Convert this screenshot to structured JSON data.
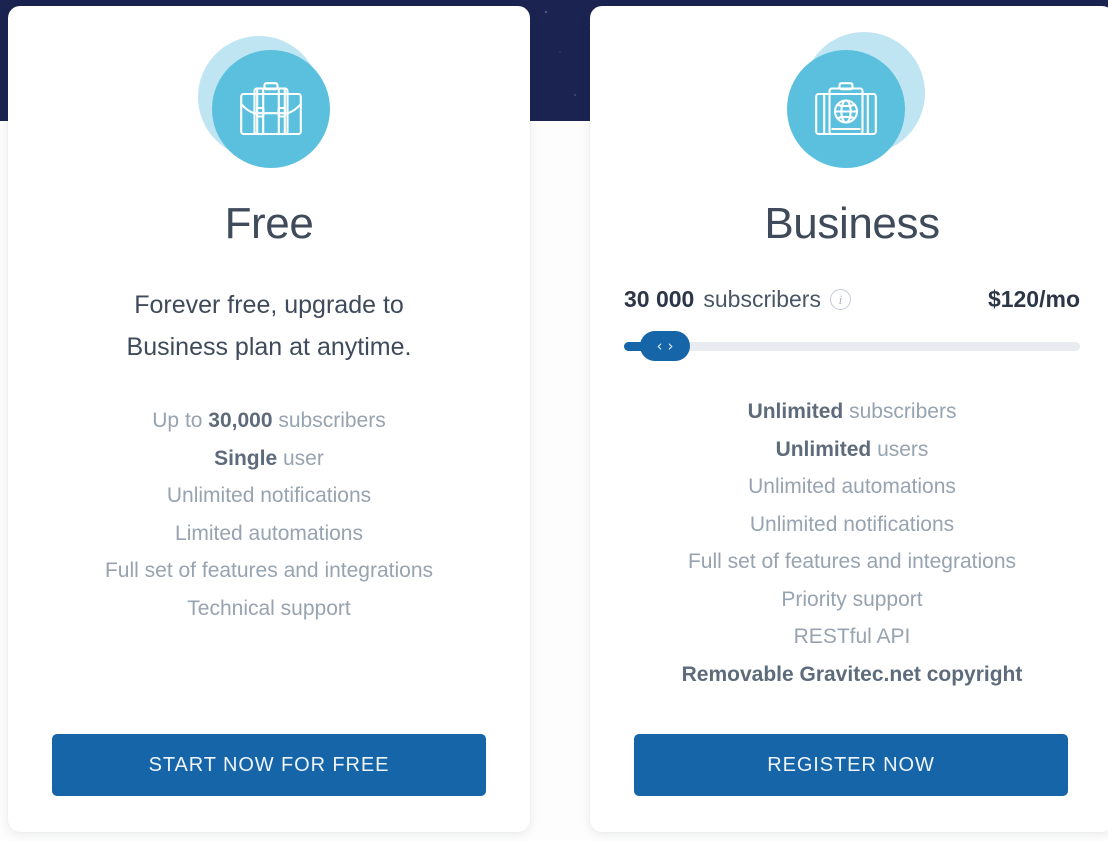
{
  "theme": {
    "night_band_color": "#1b2350",
    "card_bg": "#ffffff",
    "accent_blue": "#1565a8",
    "icon_circle": "#5bc0de",
    "icon_halo": "#bfe4f2",
    "heading_color": "#3f4a5a",
    "feature_muted": "#97a3b0",
    "feature_strong": "#5d6b7a",
    "slider_track": "#e8ecf0"
  },
  "plans": {
    "free": {
      "icon_name": "briefcase-icon",
      "title": "Free",
      "tagline_line1": "Forever free, upgrade to",
      "tagline_line2": "Business plan at anytime.",
      "features": [
        {
          "pre": "Up to ",
          "strong": "30,000",
          "post": " subscribers",
          "all_bold": false
        },
        {
          "pre": "",
          "strong": "Single",
          "post": " user",
          "all_bold": false
        },
        {
          "pre": "Unlimited notifications",
          "strong": "",
          "post": "",
          "all_bold": false
        },
        {
          "pre": "Limited automations",
          "strong": "",
          "post": "",
          "all_bold": false
        },
        {
          "pre": "Full set of features and integrations",
          "strong": "",
          "post": "",
          "all_bold": false
        },
        {
          "pre": "Technical support",
          "strong": "",
          "post": "",
          "all_bold": false
        }
      ],
      "cta_label": "START NOW FOR FREE"
    },
    "business": {
      "icon_name": "briefcase-globe-icon",
      "title": "Business",
      "subscriber_count": "30 000",
      "subscriber_word": "subscribers",
      "info_glyph": "i",
      "price": "$120/mo",
      "slider": {
        "value_percent": 9,
        "min_label": "",
        "max_label": "",
        "thumb_left_glyph": "‹",
        "thumb_right_glyph": "›"
      },
      "features": [
        {
          "pre": "",
          "strong": "Unlimited",
          "post": " subscribers",
          "all_bold": false
        },
        {
          "pre": "",
          "strong": "Unlimited",
          "post": " users",
          "all_bold": false
        },
        {
          "pre": "Unlimited automations",
          "strong": "",
          "post": "",
          "all_bold": false
        },
        {
          "pre": "Unlimited notifications",
          "strong": "",
          "post": "",
          "all_bold": false
        },
        {
          "pre": "Full set of features and integrations",
          "strong": "",
          "post": "",
          "all_bold": false
        },
        {
          "pre": "Priority support",
          "strong": "",
          "post": "",
          "all_bold": false
        },
        {
          "pre": "RESTful API",
          "strong": "",
          "post": "",
          "all_bold": false
        },
        {
          "pre": "Removable Gravitec.net copyright",
          "strong": "",
          "post": "",
          "all_bold": true
        }
      ],
      "cta_label": "REGISTER NOW"
    }
  }
}
